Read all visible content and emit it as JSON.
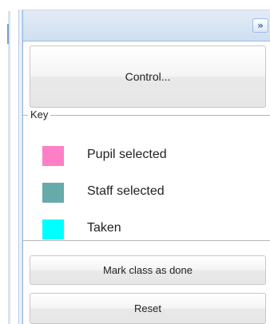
{
  "panel": {
    "collapse_icon": "double-chevron-right-icon",
    "collapse_glyph": "»"
  },
  "controls": {
    "control_label": "Control..."
  },
  "key": {
    "title": "Key",
    "items": [
      {
        "label": "Pupil selected",
        "color": "#ff7fc6"
      },
      {
        "label": "Staff selected",
        "color": "#66aaaa"
      },
      {
        "label": "Taken",
        "color": "#00ffff"
      }
    ]
  },
  "actions": {
    "mark_done_label": "Mark class as done",
    "reset_label": "Reset"
  }
}
